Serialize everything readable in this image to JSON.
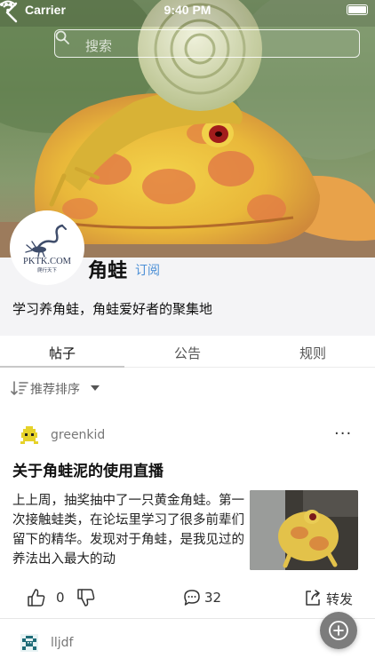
{
  "status_bar": {
    "carrier": "Carrier",
    "time": "9:40 PM"
  },
  "search": {
    "placeholder": "搜索"
  },
  "forum": {
    "name": "角蛙",
    "subscribe_label": "订阅",
    "description": "学习养角蛙，角蛙爱好者的聚集地",
    "avatar_text": "PKTK.COM",
    "avatar_subtext": "爬行天下"
  },
  "tabs": [
    {
      "label": "帖子",
      "active": true
    },
    {
      "label": "公告",
      "active": false
    },
    {
      "label": "规则",
      "active": false
    }
  ],
  "sort": {
    "label": "推荐排序"
  },
  "posts": [
    {
      "user": "greenkid",
      "more": "···",
      "title": "关于角蛙泥的使用直播",
      "body": "上上周，抽奖抽中了一只黄金角蛙。第一次接触蛙类，在论坛里学习了很多前辈们留下的精华。发现对于角蛙，是我见过的养法出入最大的动",
      "likes": "0",
      "comments": "32",
      "share_label": "转发"
    },
    {
      "user": "lljdf"
    }
  ],
  "colors": {
    "accent": "#4b8fd6",
    "profile_bg": "#f4f4f6"
  },
  "icons": [
    "back-icon",
    "search-icon",
    "sort-icon",
    "thumb-up-icon",
    "thumb-down-icon",
    "comment-icon",
    "share-icon",
    "add-icon"
  ]
}
